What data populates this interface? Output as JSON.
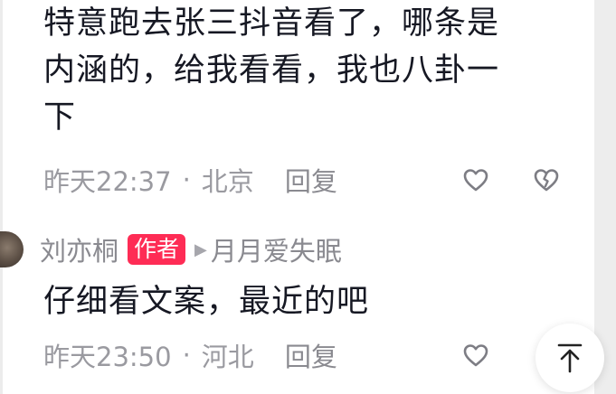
{
  "comments": [
    {
      "text_lines": [
        "特意跑去张三抖音看了，哪条是",
        "内涵的，给我看看，我也八卦一",
        "下"
      ],
      "time": "昨天22:37",
      "separator": "·",
      "location": "北京",
      "reply_label": "回复"
    },
    {
      "author": "刘亦桐",
      "author_badge": "作者",
      "reply_arrow": "▶",
      "reply_to": "月月爱失眠",
      "text": "仔细看文案，最近的吧",
      "time": "昨天23:50",
      "separator": "·",
      "location": "河北",
      "reply_label": "回复"
    }
  ],
  "icons": {
    "like": "heart-outline-icon",
    "dislike": "broken-heart-icon",
    "scroll_top": "arrow-up-to-top-icon"
  },
  "colors": {
    "text": "#161823",
    "meta": "#9a9aa0",
    "badge": "#fe2c55"
  }
}
